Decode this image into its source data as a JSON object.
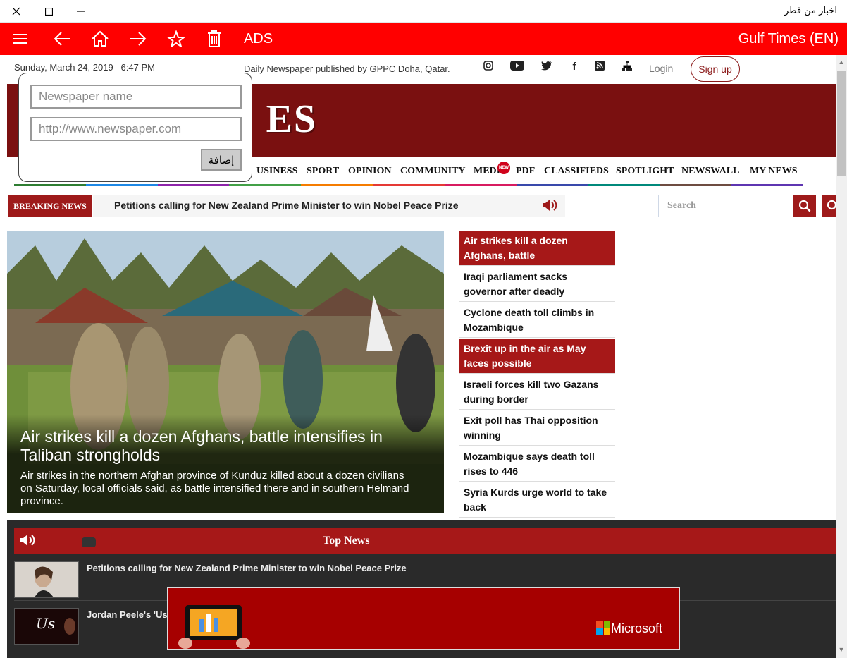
{
  "window": {
    "title": "اخبار من قطر"
  },
  "toolbar": {
    "ads_label": "ADS",
    "site_label": "Gulf Times (EN)"
  },
  "site": {
    "date": "Sunday, March 24, 2019",
    "time": "6:47 PM",
    "tagline": "Daily Newspaper published by GPPC Doha, Qatar.",
    "login": "Login",
    "signup": "Sign up",
    "logo_visible": "ES",
    "nav": [
      "USINESS",
      "SPORT",
      "OPINION",
      "COMMUNITY",
      "MEDIA",
      "PDF",
      "CLASSIFIEDS",
      "SPOTLIGHT",
      "NEWSWALL",
      "MY NEWS"
    ],
    "new_badge": "NEW",
    "breaking_tag": "BREAKING NEWS",
    "breaking_headline": "Petitions calling for New Zealand Prime Minister to win Nobel Peace Prize",
    "search_placeholder": "Search"
  },
  "hero": {
    "title": "Air strikes kill a dozen Afghans, battle intensifies in Taliban strongholds",
    "desc": "Air strikes in the northern Afghan province of Kunduz killed about a dozen civilians on Saturday, local officials said, as battle intensified there and in southern Helmand province."
  },
  "stories": [
    {
      "text": "Air strikes kill a dozen Afghans, battle",
      "active": true
    },
    {
      "text": "Iraqi parliament sacks governor after deadly",
      "active": false
    },
    {
      "text": "Cyclone death toll climbs in Mozambique",
      "active": false
    },
    {
      "text": "Brexit up in the air as May faces possible",
      "active": true
    },
    {
      "text": "Israeli forces kill two Gazans during border",
      "active": false
    },
    {
      "text": "Exit poll has Thai opposition winning",
      "active": false
    },
    {
      "text": "Mozambique says death toll rises to 446",
      "active": false
    },
    {
      "text": "Syria Kurds urge world to take back",
      "active": false
    }
  ],
  "topnews": {
    "title": "Top News",
    "items": [
      "Petitions calling for New Zealand Prime Minister to win Nobel Peace Prize",
      "Jordan Peele's 'Us"
    ]
  },
  "popup": {
    "name_placeholder": "Newspaper name",
    "url_placeholder": "http://www.newspaper.com",
    "add_label": "إضافة"
  },
  "ad": {
    "brand": "Microsoft"
  },
  "colors": {
    "toolbar": "#ff0000",
    "accent": "#9e1a1a",
    "masthead": "#7a1010"
  }
}
